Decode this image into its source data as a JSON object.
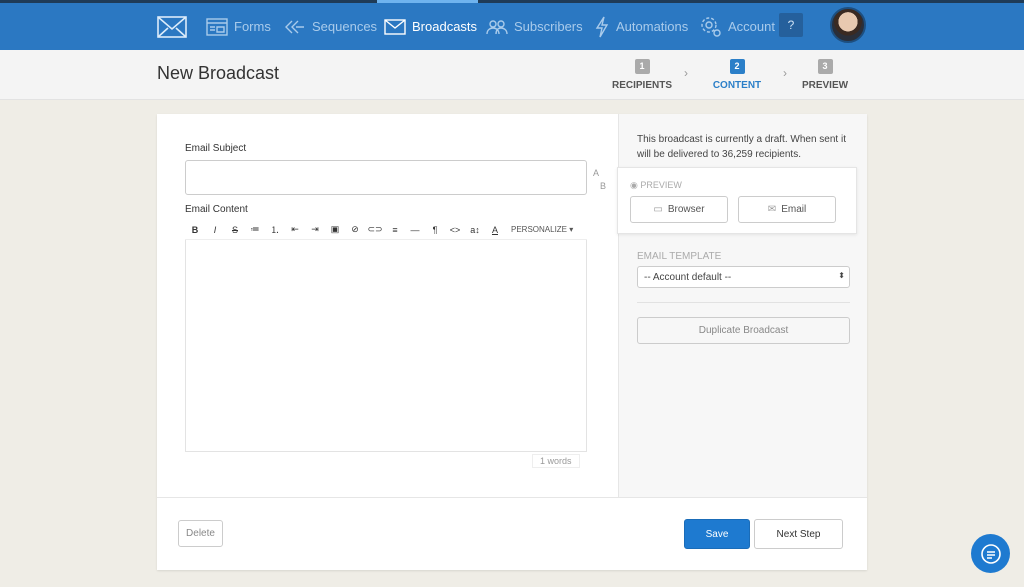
{
  "nav": {
    "items": [
      {
        "label": "Forms",
        "icon": "forms-icon"
      },
      {
        "label": "Sequences",
        "icon": "sequences-icon"
      },
      {
        "label": "Broadcasts",
        "icon": "envelope-icon",
        "active": true
      },
      {
        "label": "Subscribers",
        "icon": "subscribers-icon"
      },
      {
        "label": "Automations",
        "icon": "lightning-icon"
      },
      {
        "label": "Account",
        "icon": "gear-icon"
      }
    ],
    "help": "?"
  },
  "header": {
    "title": "New Broadcast",
    "steps": [
      {
        "num": "1",
        "label": "RECIPIENTS"
      },
      {
        "num": "2",
        "label": "CONTENT",
        "active": true
      },
      {
        "num": "3",
        "label": "PREVIEW"
      }
    ]
  },
  "form": {
    "subject_label": "Email Subject",
    "subject_value": "",
    "ab_top": "A",
    "ab_bottom": "B",
    "content_label": "Email Content",
    "toolbar": [
      "B",
      "I",
      "S",
      "≔",
      "⒈",
      "⇤",
      "⇥",
      "▣",
      "⊘",
      "⊂⊃",
      "≡",
      "—",
      "¶",
      "<>",
      "a↕",
      "A"
    ],
    "personalize": "PERSONALIZE ▾",
    "word_count": "1 words"
  },
  "sidebar": {
    "draft_text": "This broadcast is currently a draft. When sent it will be delivered to 36,259 recipients.",
    "preview_label": "PREVIEW",
    "browser": "Browser",
    "email": "Email",
    "template_label": "EMAIL TEMPLATE",
    "template_value": "-- Account default --",
    "duplicate": "Duplicate Broadcast"
  },
  "footer": {
    "delete": "Delete",
    "save": "Save",
    "next": "Next Step"
  },
  "colors": {
    "brand": "#2b78c2",
    "accent": "#2b7fc8",
    "save": "#1e7ad0"
  }
}
